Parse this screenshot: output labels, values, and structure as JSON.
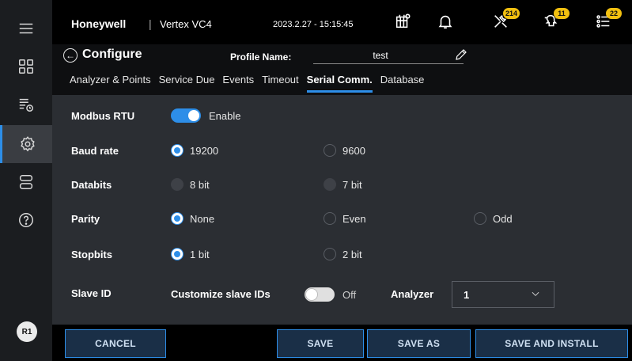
{
  "header": {
    "brand": "Honeywell",
    "separator": "|",
    "product": "Vertex VC4",
    "datetime": "2023.2.27 - 15:15:45",
    "badges": {
      "maintenance": "214",
      "faults": "11",
      "list": "22"
    }
  },
  "rail": {
    "avatar": "R1",
    "items": [
      "menu-icon",
      "dashboard-icon",
      "event-list-icon",
      "settings-icon",
      "storage-icon",
      "help-icon"
    ]
  },
  "configure": {
    "title": "Configure",
    "profile_label": "Profile Name:",
    "profile_value": "test"
  },
  "tabs": [
    {
      "label": "Analyzer & Points",
      "active": false
    },
    {
      "label": "Service Due",
      "active": false
    },
    {
      "label": "Events",
      "active": false
    },
    {
      "label": "Timeout",
      "active": false
    },
    {
      "label": "Serial Comm.",
      "active": true
    },
    {
      "label": "Database",
      "active": false
    }
  ],
  "form": {
    "modbus": {
      "label": "Modbus RTU",
      "toggle_label": "Enable",
      "enabled": true
    },
    "baud": {
      "label": "Baud rate",
      "opt1": "19200",
      "opt2": "9600",
      "selected": "19200"
    },
    "databits": {
      "label": "Databits",
      "opt1": "8 bit",
      "opt2": "7 bit"
    },
    "parity": {
      "label": "Parity",
      "opt1": "None",
      "opt2": "Even",
      "opt3": "Odd",
      "selected": "None"
    },
    "stopbits": {
      "label": "Stopbits",
      "opt1": "1 bit",
      "opt2": "2 bit",
      "selected": "1 bit"
    },
    "slave": {
      "label": "Slave ID",
      "customize_label": "Customize slave IDs",
      "customize_state": "Off",
      "analyzer_label": "Analyzer",
      "analyzer_value": "1"
    }
  },
  "footer": {
    "cancel": "CANCEL",
    "save": "SAVE",
    "save_as": "SAVE AS",
    "save_install": "SAVE AND INSTALL"
  },
  "colors": {
    "accent": "#2d8ee8",
    "panel": "#2b2e33",
    "badge": "#f2c010"
  }
}
